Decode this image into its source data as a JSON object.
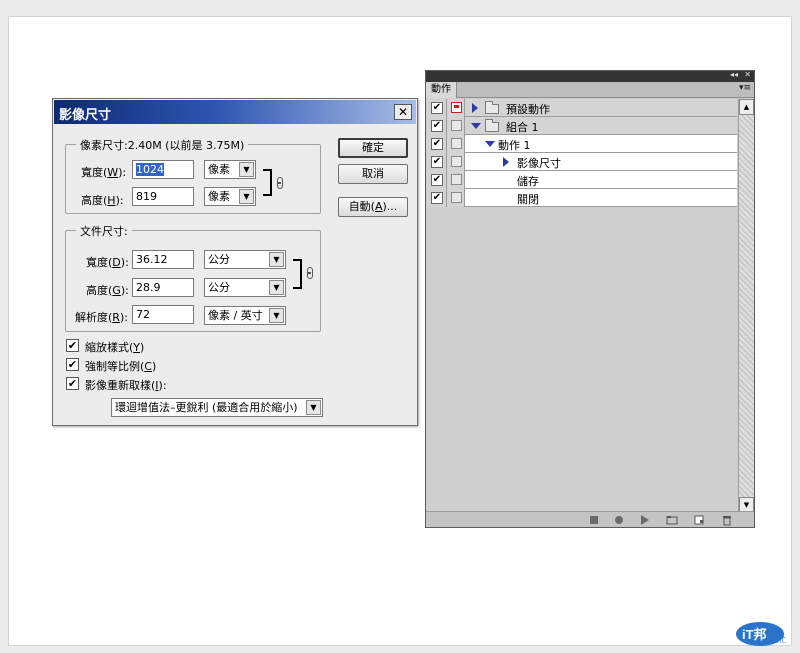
{
  "dialog": {
    "title": "影像尺寸",
    "close_glyph": "✕",
    "pixel_group": {
      "title": "像素尺寸:2.40M (以前是 3.75M)",
      "width_label": [
        "寬度(",
        "W",
        "):"
      ],
      "width_value": "1024",
      "width_unit": "像素",
      "height_label": [
        "高度(",
        "H",
        "):"
      ],
      "height_value": "819",
      "height_unit": "像素"
    },
    "doc_group": {
      "title": "文件尺寸:",
      "width_label": [
        "寬度(",
        "D",
        "):"
      ],
      "width_value": "36.12",
      "width_unit": "公分",
      "height_label": [
        "高度(",
        "G",
        "):"
      ],
      "height_value": "28.9",
      "height_unit": "公分",
      "res_label": [
        "解析度(",
        "R",
        "):"
      ],
      "res_value": "72",
      "res_unit": "像素 / 英寸"
    },
    "buttons": {
      "ok": "確定",
      "cancel": "取消",
      "auto": [
        "自動(",
        "A",
        ")..."
      ]
    },
    "checkboxes": [
      {
        "label": [
          "縮放樣式(",
          "Y",
          ")"
        ],
        "checked": true
      },
      {
        "label": [
          "強制等比例(",
          "C",
          ")"
        ],
        "checked": true
      },
      {
        "label": [
          "影像重新取樣(",
          "I",
          "):"
        ],
        "checked": true
      }
    ],
    "resample_method": "環迴增值法–更銳利 (最適合用於縮小)"
  },
  "actions_panel": {
    "collapse_glyph": "◂◂",
    "close_glyph": "✕",
    "tab_label": "動作",
    "menu_glyph": "▾≡",
    "rows": [
      {
        "label": "預設動作"
      },
      {
        "label": "組合 1"
      },
      {
        "label": "動作 1"
      },
      {
        "label": "影像尺寸"
      },
      {
        "label": "儲存"
      },
      {
        "label": "關閉"
      }
    ],
    "check_glyph": "✔",
    "scroll_up": "▲",
    "scroll_down": "▼"
  },
  "logo": {
    "text": "iT邦",
    "subtext": "幫忙",
    "brand_color": "#2a74c9"
  }
}
